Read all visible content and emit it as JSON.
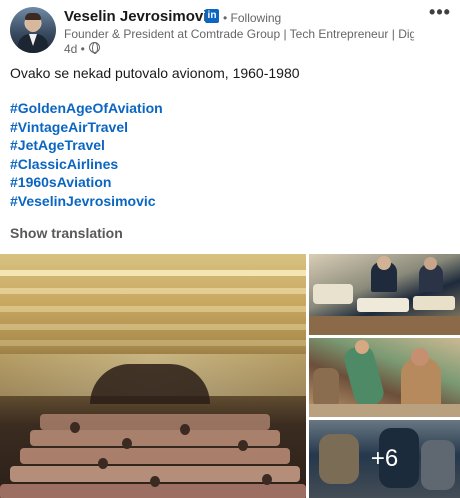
{
  "author": {
    "name": "Veselin Jevrosimovic",
    "badge": "in",
    "follow_status": "• Following",
    "headline": "Founder & President at Comtrade Group | Tech Entrepreneur | Digita...",
    "time": "4d •",
    "visibility_icon": "globe-icon",
    "menu": "•••"
  },
  "post": {
    "text": "Ovako se nekad putovalo avionom, 1960-1980",
    "hashtags": [
      "#GoldenAgeOfAviation",
      "#VintageAirTravel",
      "#JetAgeTravel",
      "#ClassicAirlines",
      "#1960sAviation",
      "#VeselinJevrosimovic"
    ],
    "show_translation": "Show translation"
  },
  "media": {
    "extra_count": "+6"
  },
  "colors": {
    "link": "#0a66c2",
    "text": "#191919",
    "muted": "#666666"
  }
}
